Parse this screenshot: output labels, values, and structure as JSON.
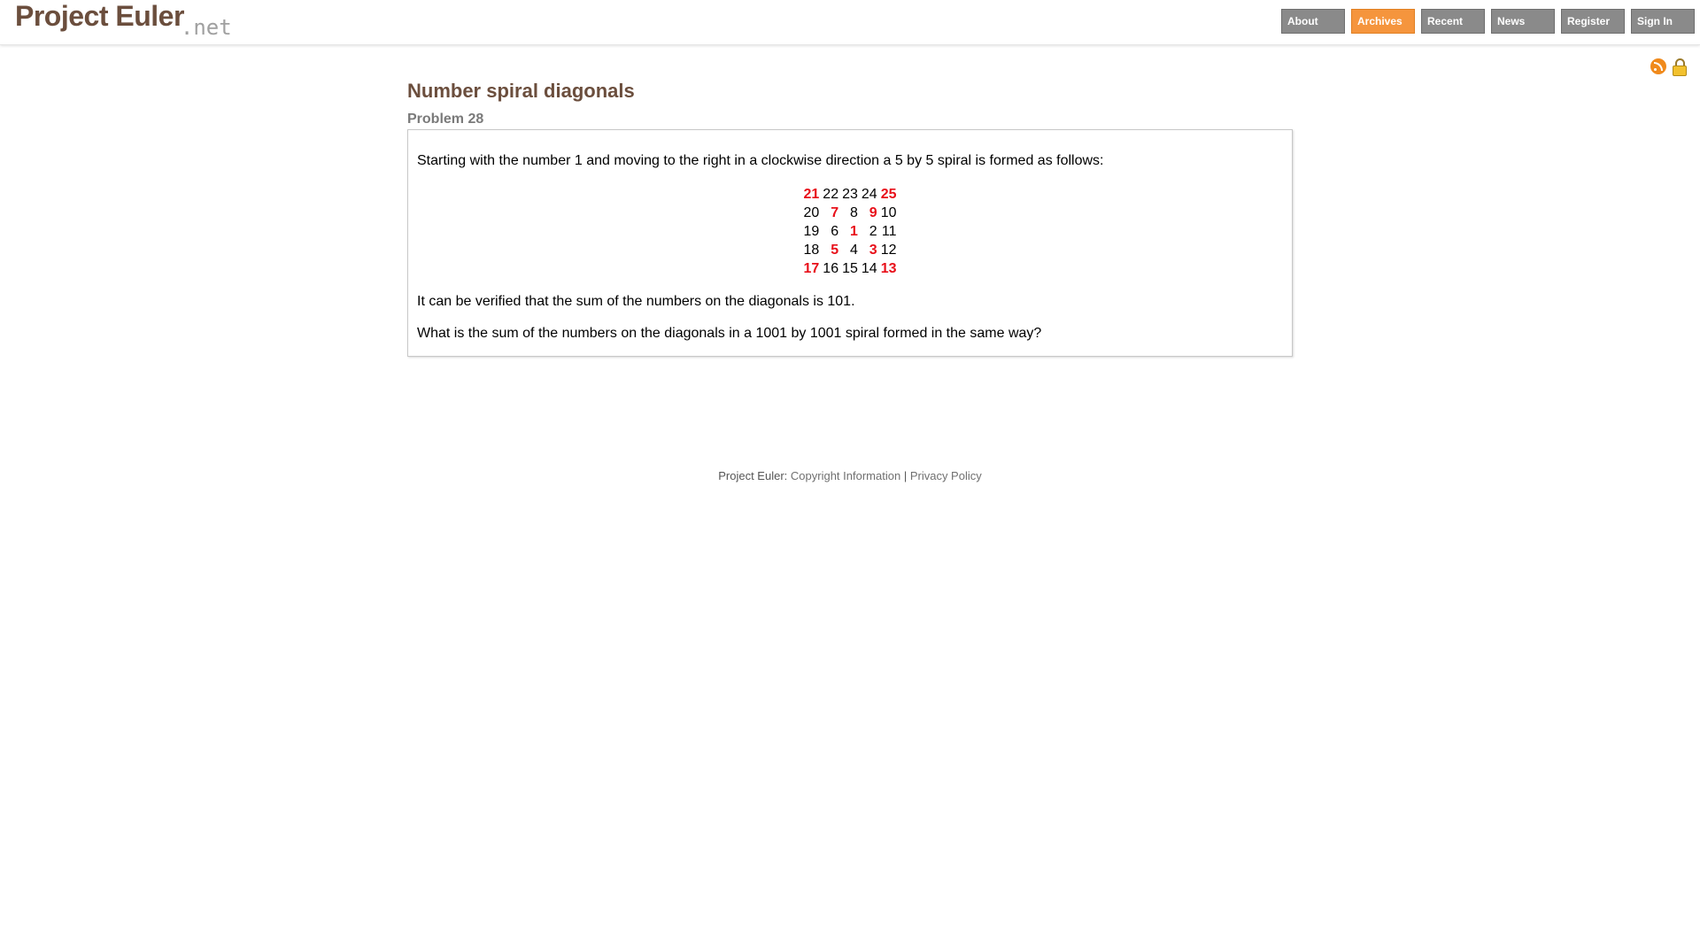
{
  "header": {
    "logo_main": "Project Euler",
    "logo_suffix": ".net",
    "nav": [
      {
        "label": "About",
        "active": false
      },
      {
        "label": "Archives",
        "active": true
      },
      {
        "label": "Recent",
        "active": false
      },
      {
        "label": "News",
        "active": false
      },
      {
        "label": "Register",
        "active": false
      },
      {
        "label": "Sign In",
        "active": false
      }
    ]
  },
  "icons": [
    "rss-icon",
    "lock-icon"
  ],
  "colors": {
    "title": "#6b4e3d",
    "nav_default": "#8a8a8a",
    "nav_active": "#f5953d",
    "diagonal_numbers": "#e8101a"
  },
  "problem": {
    "title": "Number spiral diagonals",
    "number_label": "Problem 28",
    "intro": "Starting with the number 1 and moving to the right in a clockwise direction a 5 by 5 spiral is formed as follows:",
    "spiral": [
      [
        "21",
        "22",
        "23",
        "24",
        "25"
      ],
      [
        "20",
        "7",
        "8",
        "9",
        "10"
      ],
      [
        "19",
        "6",
        "1",
        "2",
        "11"
      ],
      [
        "18",
        "5",
        "4",
        "3",
        "12"
      ],
      [
        "17",
        "16",
        "15",
        "14",
        "13"
      ]
    ],
    "verification": "It can be verified that the sum of the numbers on the diagonals is 101.",
    "question": "What is the sum of the numbers on the diagonals in a 1001 by 1001 spiral formed in the same way?"
  },
  "footer": {
    "prefix": "Project Euler:",
    "copyright_link": "Copyright Information",
    "separator": "|",
    "privacy_link": "Privacy Policy"
  }
}
